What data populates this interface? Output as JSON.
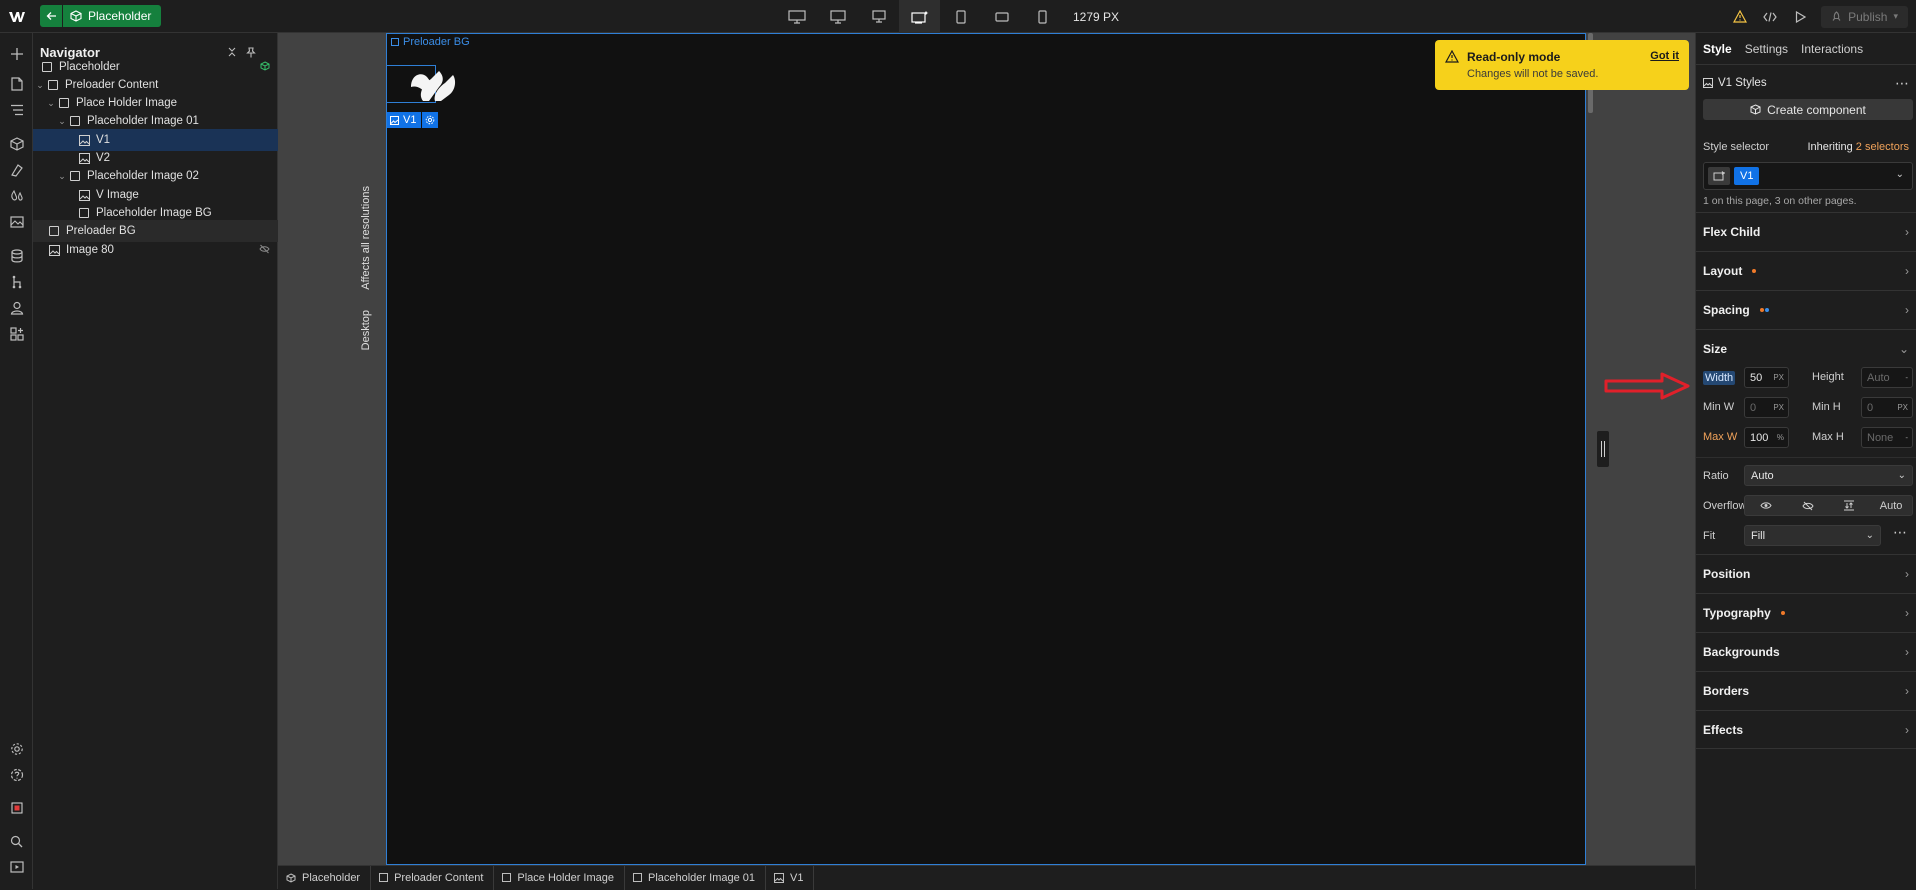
{
  "topbar": {
    "component_name": "Placeholder",
    "viewport_width": "1279 PX",
    "publish_label": "Publish",
    "breakpoints": [
      "desktop-large-icon",
      "desktop-medium-icon",
      "desktop-small-icon",
      "desktop-base-icon",
      "tablet-icon",
      "mobile-landscape-icon",
      "mobile-portrait-icon"
    ]
  },
  "navigator": {
    "title": "Navigator",
    "items": [
      {
        "label": "Placeholder"
      },
      {
        "label": "Preloader Content"
      },
      {
        "label": "Place Holder Image"
      },
      {
        "label": "Placeholder Image 01"
      },
      {
        "label": "V1"
      },
      {
        "label": "V2"
      },
      {
        "label": "Placeholder Image 02"
      },
      {
        "label": "V Image"
      },
      {
        "label": "Placeholder Image BG"
      },
      {
        "label": "Preloader BG"
      },
      {
        "label": "Image 80"
      }
    ]
  },
  "canvas": {
    "side_label_1": "Affects all resolutions",
    "side_label_2": "Desktop",
    "element_label": "Preloader BG",
    "selected_tag": "V1"
  },
  "toast": {
    "title": "Read-only mode",
    "message": "Changes will not be saved.",
    "action": "Got it"
  },
  "breadcrumb": [
    "Placeholder",
    "Preloader Content",
    "Place Holder Image",
    "Placeholder Image 01",
    "V1"
  ],
  "style_panel": {
    "tabs": [
      "Style",
      "Settings",
      "Interactions"
    ],
    "styles_title": "V1 Styles",
    "create_component": "Create component",
    "selector_label": "Style selector",
    "inheriting_prefix": "Inheriting",
    "inheriting_count": "2 selectors",
    "selector_chip": "V1",
    "selector_info": "1 on this page, 3 on other pages.",
    "sections": {
      "flex_child": "Flex Child",
      "layout": "Layout",
      "spacing": "Spacing",
      "size": "Size",
      "position": "Position",
      "typography": "Typography",
      "backgrounds": "Backgrounds",
      "borders": "Borders",
      "effects": "Effects"
    },
    "size": {
      "width_label": "Width",
      "width_value": "50",
      "width_unit": "PX",
      "height_label": "Height",
      "height_value": "Auto",
      "height_unit": "-",
      "minw_label": "Min W",
      "minw_value": "0",
      "minw_unit": "PX",
      "minh_label": "Min H",
      "minh_value": "0",
      "minh_unit": "PX",
      "maxw_label": "Max W",
      "maxw_value": "100",
      "maxw_unit": "%",
      "maxh_label": "Max H",
      "maxh_value": "None",
      "maxh_unit": "-",
      "ratio_label": "Ratio",
      "ratio_value": "Auto",
      "overflow_label": "Overflow",
      "overflow_auto": "Auto",
      "fit_label": "Fit",
      "fit_value": "Fill"
    },
    "colors": {
      "accent": "#1172e6",
      "inherit": "#f0a25a",
      "warning": "#f6d11b",
      "component": "#15803d"
    }
  }
}
